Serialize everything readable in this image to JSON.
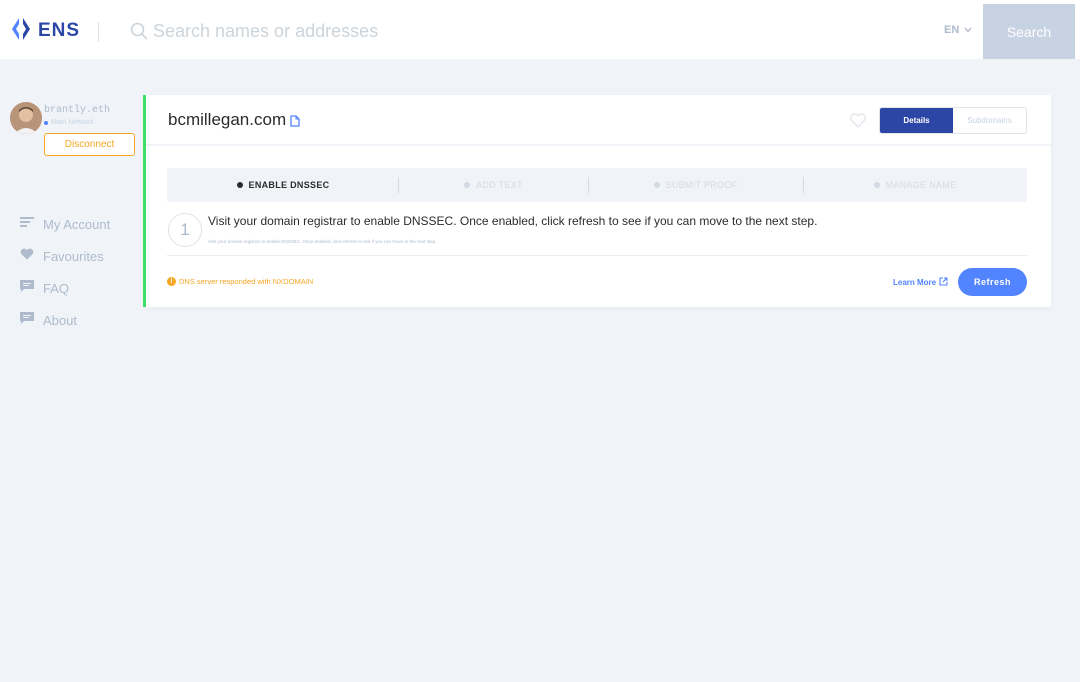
{
  "header": {
    "logo_text": "ENS",
    "logo_icon": "ens-logo-icon",
    "search_placeholder": "Search names or addresses",
    "search_value": "",
    "language": "EN",
    "search_button": "Search"
  },
  "account": {
    "name": "brantly.eth",
    "network": "Main Network",
    "disconnect_label": "Disconnect"
  },
  "nav": {
    "items": [
      {
        "label": "My Account",
        "icon": "account-icon"
      },
      {
        "label": "Favourites",
        "icon": "heart-icon"
      },
      {
        "label": "FAQ",
        "icon": "chat-icon"
      },
      {
        "label": "About",
        "icon": "chat-icon"
      }
    ]
  },
  "domain": {
    "name": "bcmillegan.com",
    "tabs": {
      "details": "Details",
      "subdomains": "Subdomains"
    },
    "active_tab": "Details"
  },
  "steps": {
    "items": [
      "ENABLE DNSSEC",
      "ADD TEXT",
      "SUBMIT PROOF",
      "MANAGE NAME"
    ],
    "current_index": 0,
    "current_number": "1",
    "instruction": "Visit your domain registrar to enable DNSSEC. Once enabled, click refresh to see if you can move to the next step.",
    "instruction_small": "Visit your domain registrar to enable DNSSEC. Once enabled, click refresh to see if you can move to the next step."
  },
  "status": {
    "message": "DNS server responded with NXDOMAIN",
    "learn_more": "Learn More",
    "refresh_label": "Refresh"
  },
  "colors": {
    "brand": "#2C46A6",
    "primary": "#5284FF",
    "warning": "#F5A623",
    "accent_bar": "#42E068",
    "muted": "#ADBBCD"
  }
}
